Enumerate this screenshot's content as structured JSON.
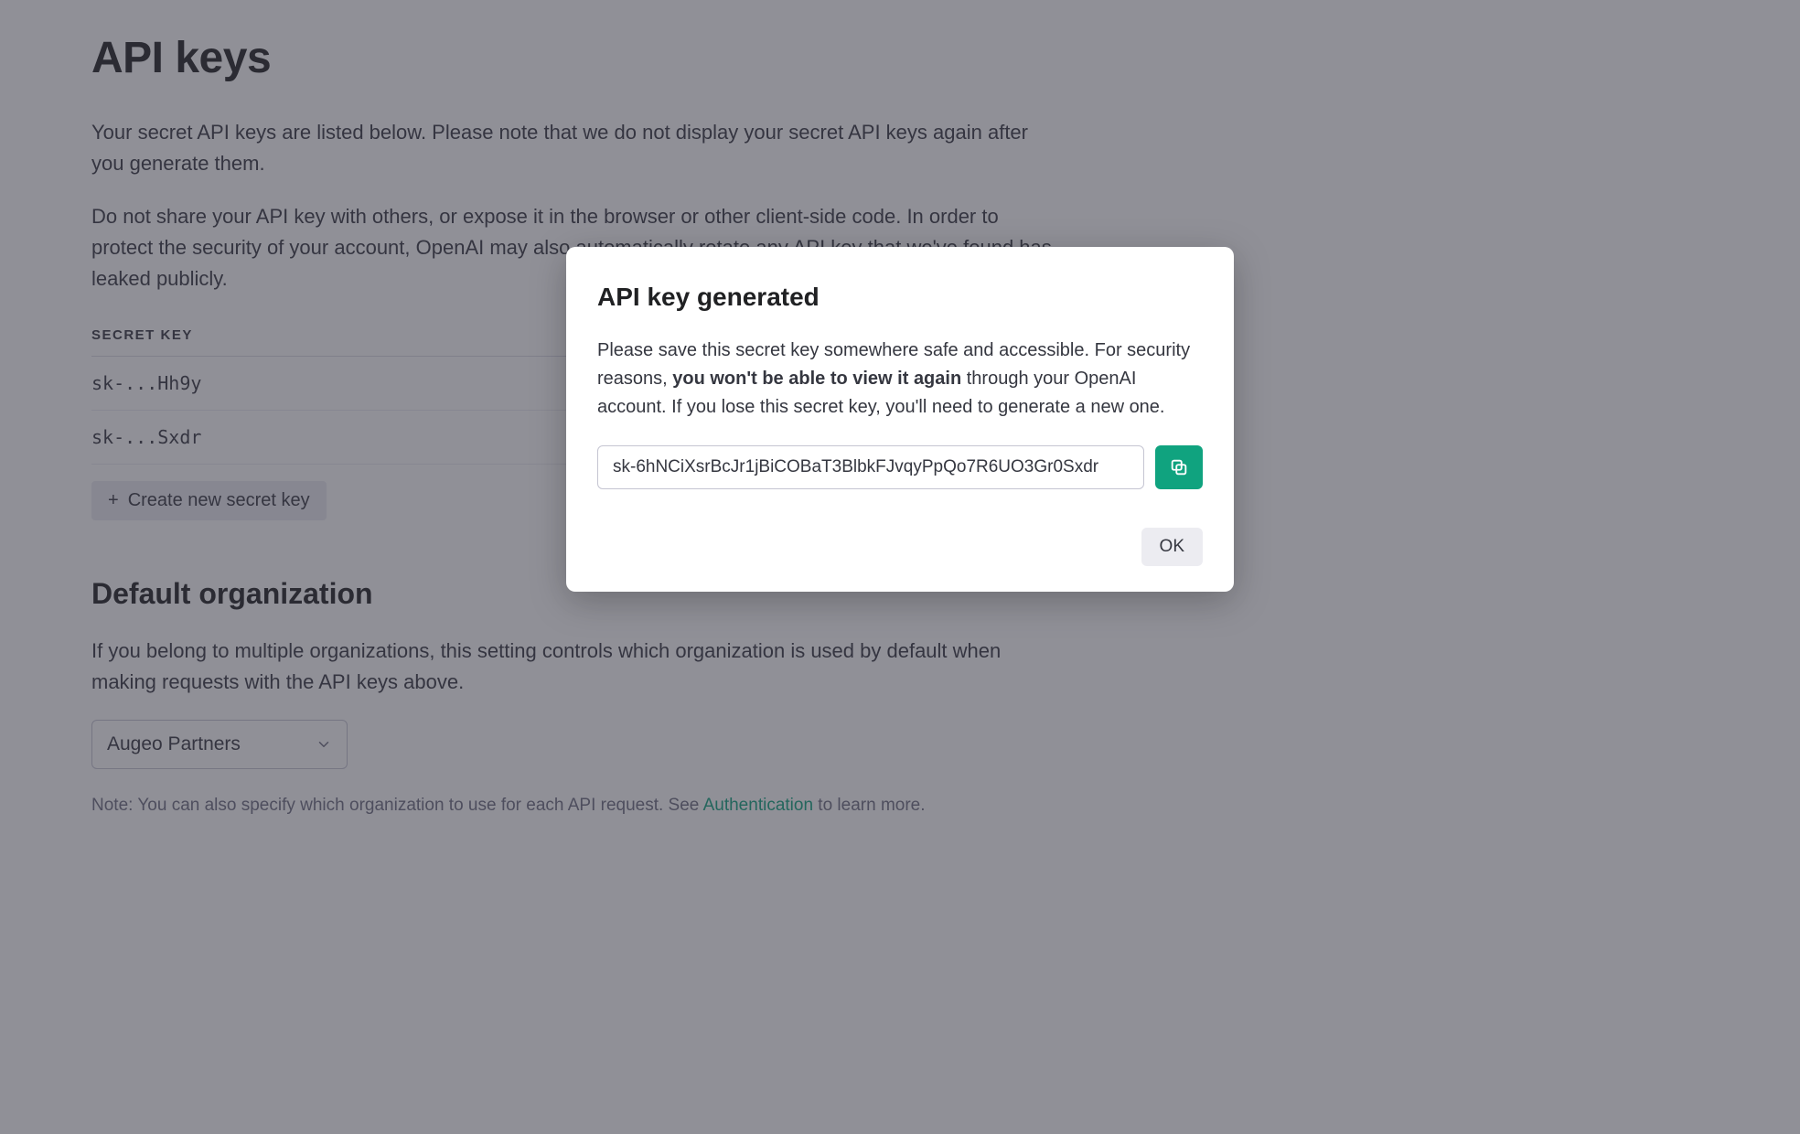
{
  "page": {
    "title": "API keys",
    "intro1": "Your secret API keys are listed below. Please note that we do not display your secret API keys again after you generate them.",
    "intro2": "Do not share your API key with others, or expose it in the browser or other client-side code. In order to protect the security of your account, OpenAI may also automatically rotate any API key that we've found has leaked publicly."
  },
  "keys": {
    "header": "SECRET KEY",
    "rows": [
      "sk-...Hh9y",
      "sk-...Sxdr"
    ],
    "create_label": "Create new secret key"
  },
  "org": {
    "heading": "Default organization",
    "desc": "If you belong to multiple organizations, this setting controls which organization is used by default when making requests with the API keys above.",
    "selected": "Augeo Partners",
    "note_prefix": "Note: You can also specify which organization to use for each API request. See ",
    "note_link": "Authentication",
    "note_suffix": " to learn more."
  },
  "modal": {
    "title": "API key generated",
    "body_prefix": "Please save this secret key somewhere safe and accessible. For security reasons, ",
    "body_bold": "you won't be able to view it again",
    "body_suffix": " through your OpenAI account. If you lose this secret key, you'll need to generate a new one.",
    "key_value": "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",
    "ok_label": "OK"
  },
  "colors": {
    "accent": "#10a37f",
    "text": "#353740",
    "muted": "#6e6e80",
    "surface": "#ececf1"
  }
}
